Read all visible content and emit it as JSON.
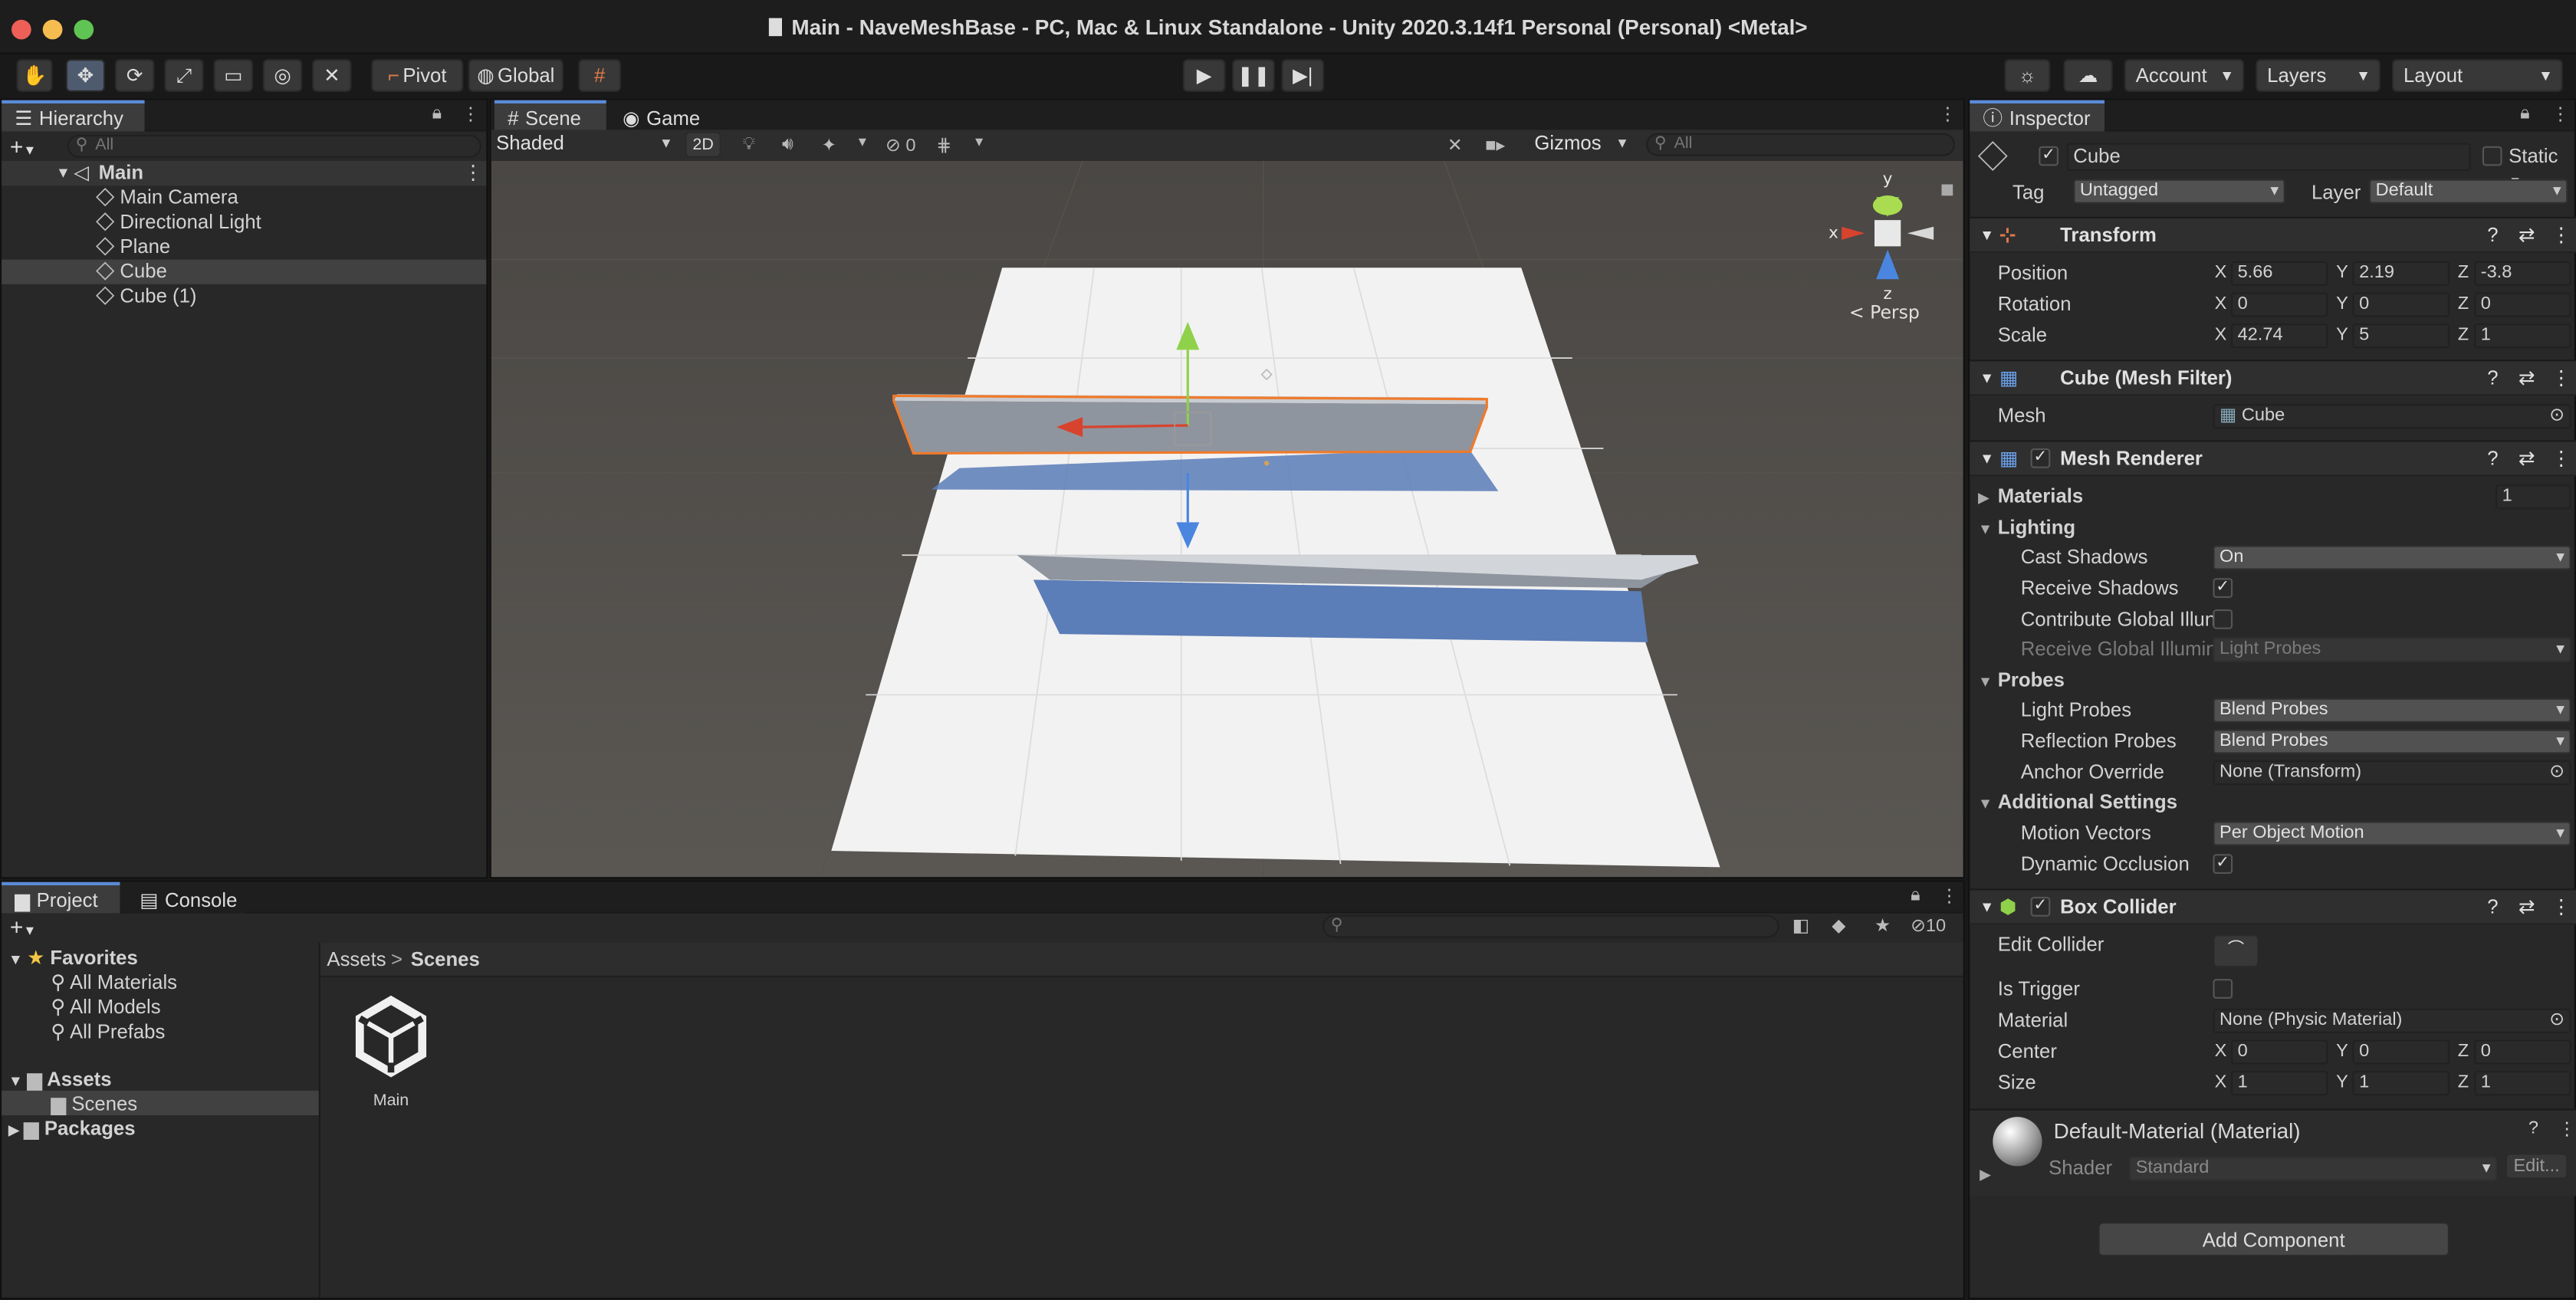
{
  "window": {
    "title": "Main - NaveMeshBase - PC, Mac & Linux Standalone - Unity 2020.3.14f1 Personal (Personal) <Metal>"
  },
  "toolbar": {
    "pivot": "Pivot",
    "global": "Global",
    "account": "Account",
    "layers": "Layers",
    "layout": "Layout"
  },
  "hierarchy": {
    "tab": "Hierarchy",
    "search_placeholder": "All",
    "scene": "Main",
    "items": [
      "Main Camera",
      "Directional Light",
      "Plane",
      "Cube",
      "Cube (1)"
    ]
  },
  "scene_view": {
    "tab_scene": "Scene",
    "tab_game": "Game",
    "shading": "Shaded",
    "mode_2d": "2D",
    "hidden_count": "0",
    "gizmos": "Gizmos",
    "search_placeholder": "All",
    "persp": "< Persp",
    "axis_x": "x",
    "axis_y": "y",
    "axis_z": "z"
  },
  "project": {
    "tab_project": "Project",
    "tab_console": "Console",
    "favorites": "Favorites",
    "fav_items": [
      "All Materials",
      "All Models",
      "All Prefabs"
    ],
    "assets": "Assets",
    "scenes": "Scenes",
    "packages": "Packages",
    "breadcrumb_assets": "Assets",
    "breadcrumb_sep": ">",
    "breadcrumb_scenes": "Scenes",
    "hidden_count": "10",
    "asset_name": "Main"
  },
  "inspector": {
    "tab": "Inspector",
    "object_name": "Cube",
    "static": "Static",
    "tag_label": "Tag",
    "tag_value": "Untagged",
    "layer_label": "Layer",
    "layer_value": "Default",
    "transform": {
      "title": "Transform",
      "position_label": "Position",
      "position": [
        "5.66",
        "2.19",
        "-3.8"
      ],
      "rotation_label": "Rotation",
      "rotation": [
        "0",
        "0",
        "0"
      ],
      "scale_label": "Scale",
      "scale": [
        "42.74",
        "5",
        "1"
      ]
    },
    "mesh_filter": {
      "title": "Cube (Mesh Filter)",
      "mesh_label": "Mesh",
      "mesh_value": "Cube"
    },
    "mesh_renderer": {
      "title": "Mesh Renderer",
      "materials_label": "Materials",
      "materials_count": "1",
      "lighting": "Lighting",
      "cast_shadows_label": "Cast Shadows",
      "cast_shadows": "On",
      "receive_shadows_label": "Receive Shadows",
      "contribute_gi_label": "Contribute Global Illun",
      "receive_gi_label": "Receive Global Illumin",
      "receive_gi": "Light Probes",
      "probes": "Probes",
      "light_probes_label": "Light Probes",
      "light_probes": "Blend Probes",
      "reflection_probes_label": "Reflection Probes",
      "reflection_probes": "Blend Probes",
      "anchor_override_label": "Anchor Override",
      "anchor_override": "None (Transform)",
      "additional": "Additional Settings",
      "motion_vectors_label": "Motion Vectors",
      "motion_vectors": "Per Object Motion",
      "dynamic_occlusion_label": "Dynamic Occlusion"
    },
    "box_collider": {
      "title": "Box Collider",
      "edit_collider_label": "Edit Collider",
      "is_trigger_label": "Is Trigger",
      "material_label": "Material",
      "material": "None (Physic Material)",
      "center_label": "Center",
      "center": [
        "0",
        "0",
        "0"
      ],
      "size_label": "Size",
      "size": [
        "1",
        "1",
        "1"
      ]
    },
    "material": {
      "title": "Default-Material (Material)",
      "shader_label": "Shader",
      "shader": "Standard",
      "edit": "Edit..."
    },
    "add_component": "Add Component",
    "axes": [
      "X",
      "Y",
      "Z"
    ]
  },
  "colors": {
    "accent": "#5a8bd6",
    "selection": "#414141",
    "x_axis": "#d8432e",
    "y_axis": "#8fd14a",
    "z_axis": "#4a86e0",
    "wall_outline": "#f07a2a"
  }
}
